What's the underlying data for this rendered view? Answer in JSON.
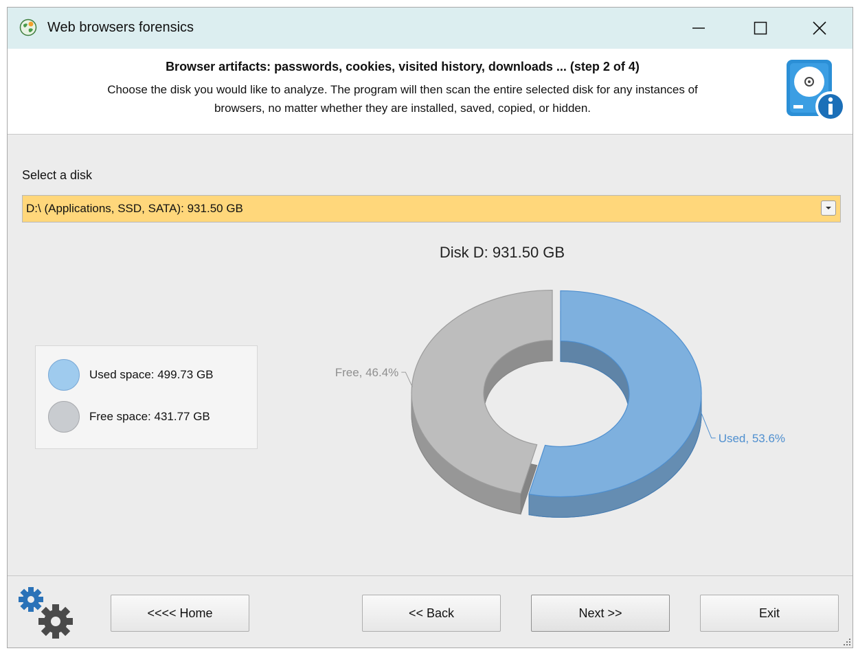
{
  "window": {
    "title": "Web browsers forensics",
    "controls": {
      "minimize": "minimize-icon",
      "maximize": "maximize-icon",
      "close": "close-icon"
    }
  },
  "header": {
    "title": "Browser artifacts: passwords, cookies, visited history, downloads ... (step 2 of 4)",
    "description_line1": "Choose the disk you would like to analyze. The program will then scan the entire selected disk for any instances of",
    "description_line2": "browsers, no matter whether they are installed, saved, copied, or hidden."
  },
  "disk_select": {
    "label": "Select a disk",
    "value": "D:\\  (Applications, SSD, SATA):  931.50 GB",
    "background_color": "#ffd77b"
  },
  "legend": {
    "items": [
      {
        "label": "Used space: 499.73 GB",
        "color": "#9fcbee"
      },
      {
        "label": "Free space: 431.77 GB",
        "color": "#c9ccd0"
      }
    ]
  },
  "chart_data": {
    "type": "pie",
    "style": "3d-doughnut",
    "title": "Disk D: 931.50 GB",
    "slices": [
      {
        "name": "Used",
        "value": 53.6,
        "label": "Used, 53.6%",
        "color": "#7eb0de",
        "stroke": "#4f8fcf"
      },
      {
        "name": "Free",
        "value": 46.4,
        "label": "Free, 46.4%",
        "color": "#bdbdbd",
        "stroke": "#9c9c9c"
      }
    ]
  },
  "buttons": {
    "home": "<<<< Home",
    "back": "<< Back",
    "next": "Next >>",
    "exit": "Exit"
  }
}
